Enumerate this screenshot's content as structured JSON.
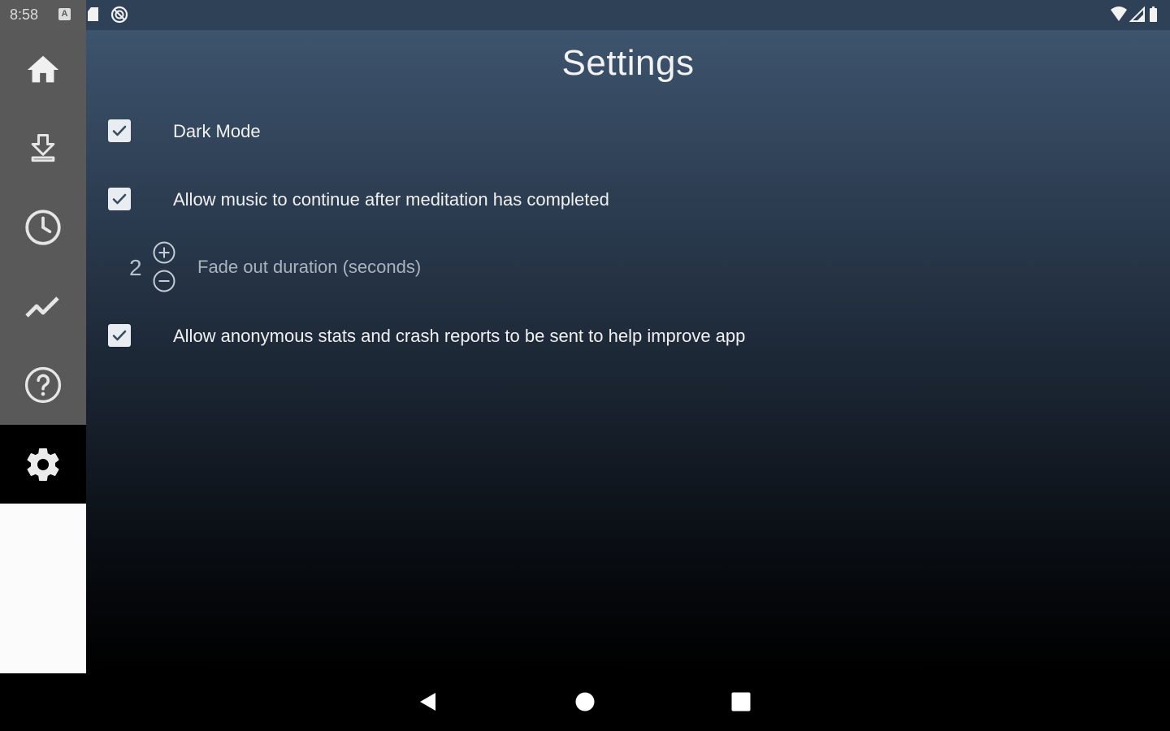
{
  "status_bar": {
    "time": "8:58",
    "badge_letter": "A",
    "icons": [
      "notification-a-icon",
      "sd-card-icon",
      "data-saver-icon",
      "wifi-icon",
      "signal-icon",
      "battery-icon"
    ]
  },
  "sidebar": {
    "items": [
      {
        "name": "home",
        "icon": "home-icon",
        "active": false
      },
      {
        "name": "downloads",
        "icon": "download-icon",
        "active": false
      },
      {
        "name": "timer",
        "icon": "clock-icon",
        "active": false
      },
      {
        "name": "stats",
        "icon": "trending-up-icon",
        "active": false
      },
      {
        "name": "help",
        "icon": "help-icon",
        "active": false
      },
      {
        "name": "settings",
        "icon": "gear-icon",
        "active": true
      }
    ]
  },
  "main": {
    "title": "Settings",
    "settings": [
      {
        "label": "Dark Mode",
        "checked": true
      },
      {
        "label": "Allow music to continue after meditation has completed",
        "checked": true
      },
      {
        "label": "Allow anonymous stats and crash reports to be sent to help improve app",
        "checked": true
      }
    ],
    "fade_out": {
      "value": "2",
      "label": "Fade out duration (seconds)"
    }
  },
  "nav_bar": {
    "icons": [
      "back-icon",
      "home-circle-icon",
      "recents-icon"
    ]
  },
  "colors": {
    "gradient_top": "#3d546d",
    "gradient_bottom": "#000000",
    "sidebar_bg": "#595959",
    "active_nav_bg": "#000000",
    "checkbox_bg": "#e9edf1"
  }
}
